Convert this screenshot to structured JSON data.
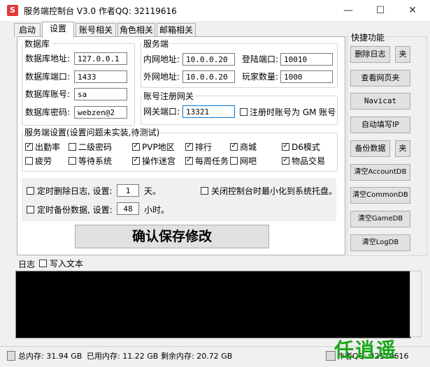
{
  "window": {
    "title": "服务端控制台 V3.0 作者QQ: 32119616",
    "icon_text": "S",
    "minimize": "—",
    "maximize": "☐",
    "close": "✕"
  },
  "tabs": [
    "启动",
    "设置",
    "账号相关",
    "角色相关",
    "邮箱相关"
  ],
  "active_tab": "设置",
  "database": {
    "title": "数据库",
    "address_label": "数据库地址:",
    "address_value": "127.0.0.1",
    "port_label": "数据库端口:",
    "port_value": "1433",
    "account_label": "数据库账号:",
    "account_value": "sa",
    "password_label": "数据库密码:",
    "password_value": "webzen@2"
  },
  "server": {
    "title": "服务端",
    "intranet_label": "内网地址:",
    "intranet_value": "10.0.0.20",
    "login_port_label": "登陆端口:",
    "login_port_value": "10010",
    "extranet_label": "外网地址:",
    "extranet_value": "10.0.0.20",
    "player_count_label": "玩家数量:",
    "player_count_value": "1000"
  },
  "registration": {
    "title": "账号注册网关",
    "gateway_port_label": "网关端口:",
    "gateway_port_value": "13321",
    "gm_checkbox_label": "注册时账号为 GM 账号",
    "gm_checked": false
  },
  "server_settings": {
    "title": "服务端设置(设置问题未实装,待测试)",
    "options": [
      {
        "label": "出勤率",
        "checked": true
      },
      {
        "label": "二级密码",
        "checked": false
      },
      {
        "label": "PVP地区",
        "checked": true
      },
      {
        "label": "排行",
        "checked": true
      },
      {
        "label": "商城",
        "checked": true
      },
      {
        "label": "D6模式",
        "checked": true
      },
      {
        "label": "疲劳",
        "checked": false
      },
      {
        "label": "等待系统",
        "checked": false
      },
      {
        "label": "操作迷宫",
        "checked": true
      },
      {
        "label": "每周任务",
        "checked": true
      },
      {
        "label": "网吧",
        "checked": false
      },
      {
        "label": "物品交易",
        "checked": true
      }
    ]
  },
  "schedule": {
    "delete_log_label": "定时删除日志, 设置:",
    "delete_log_value": "1",
    "delete_log_unit": "天。",
    "delete_log_checked": false,
    "backup_label": "定时备份数据, 设置:",
    "backup_value": "48",
    "backup_unit": "小时。",
    "backup_checked": false,
    "tray_label": "关闭控制台时最小化到系统托盘。",
    "tray_checked": false
  },
  "save_button": "确认保存修改",
  "quick": {
    "title": "快捷功能",
    "delete_log": "删除日志",
    "clip": "夹",
    "view_web": "查看网页夹",
    "navicat": "Navicat",
    "auto_ip": "自动填写IP",
    "backup": "备份数据",
    "clip2": "夹",
    "clear_account": "清空AccountDB",
    "clear_common": "清空CommonDB",
    "clear_game": "清空GameDB",
    "clear_log": "清空LogDB"
  },
  "log": {
    "label": "日志",
    "write_text_label": "写入文本",
    "write_text_checked": false
  },
  "status": {
    "total_memory": "总内存: 31.94 GB",
    "used_memory": "已用内存: 11.22 GB",
    "free_memory": "剩余内存: 20.72 GB",
    "author_qq": "作者QQ: 32119616"
  },
  "watermark": "任逍遥"
}
